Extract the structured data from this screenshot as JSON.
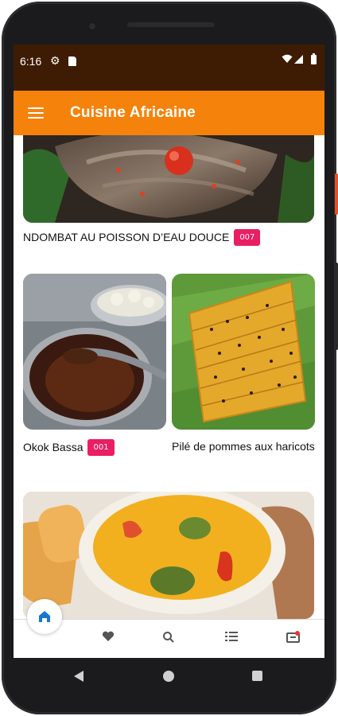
{
  "status_bar": {
    "time": "6:16",
    "icons": [
      "gear-icon",
      "sd-card-icon",
      "wifi-icon",
      "signal-icon",
      "battery-icon"
    ]
  },
  "app_bar": {
    "title": "Cuisine Africaine",
    "menu_icon": "hamburger-menu-icon",
    "background": "#f5820b"
  },
  "recipes": [
    {
      "name": "NDOMBAT AU POISSON D’EAU DOUCE",
      "badge": "007",
      "image": "grilled-fish-dish"
    },
    {
      "name": "Okok Bassa",
      "badge": "001",
      "image": "okok-pot"
    },
    {
      "name": "Pilé de pommes aux haricots",
      "badge": "",
      "image": "pile-pommes-haricots"
    },
    {
      "name": "",
      "badge": "",
      "image": "yellow-soup-with-shrimp"
    }
  ],
  "bottom_nav": {
    "items": [
      "home-icon",
      "heart-icon",
      "search-icon",
      "list-icon",
      "video-icon"
    ],
    "active": "home-icon",
    "active_color": "#1976d2"
  },
  "colors": {
    "status_bar": "#3e1c03",
    "badge": "#e91e63"
  }
}
